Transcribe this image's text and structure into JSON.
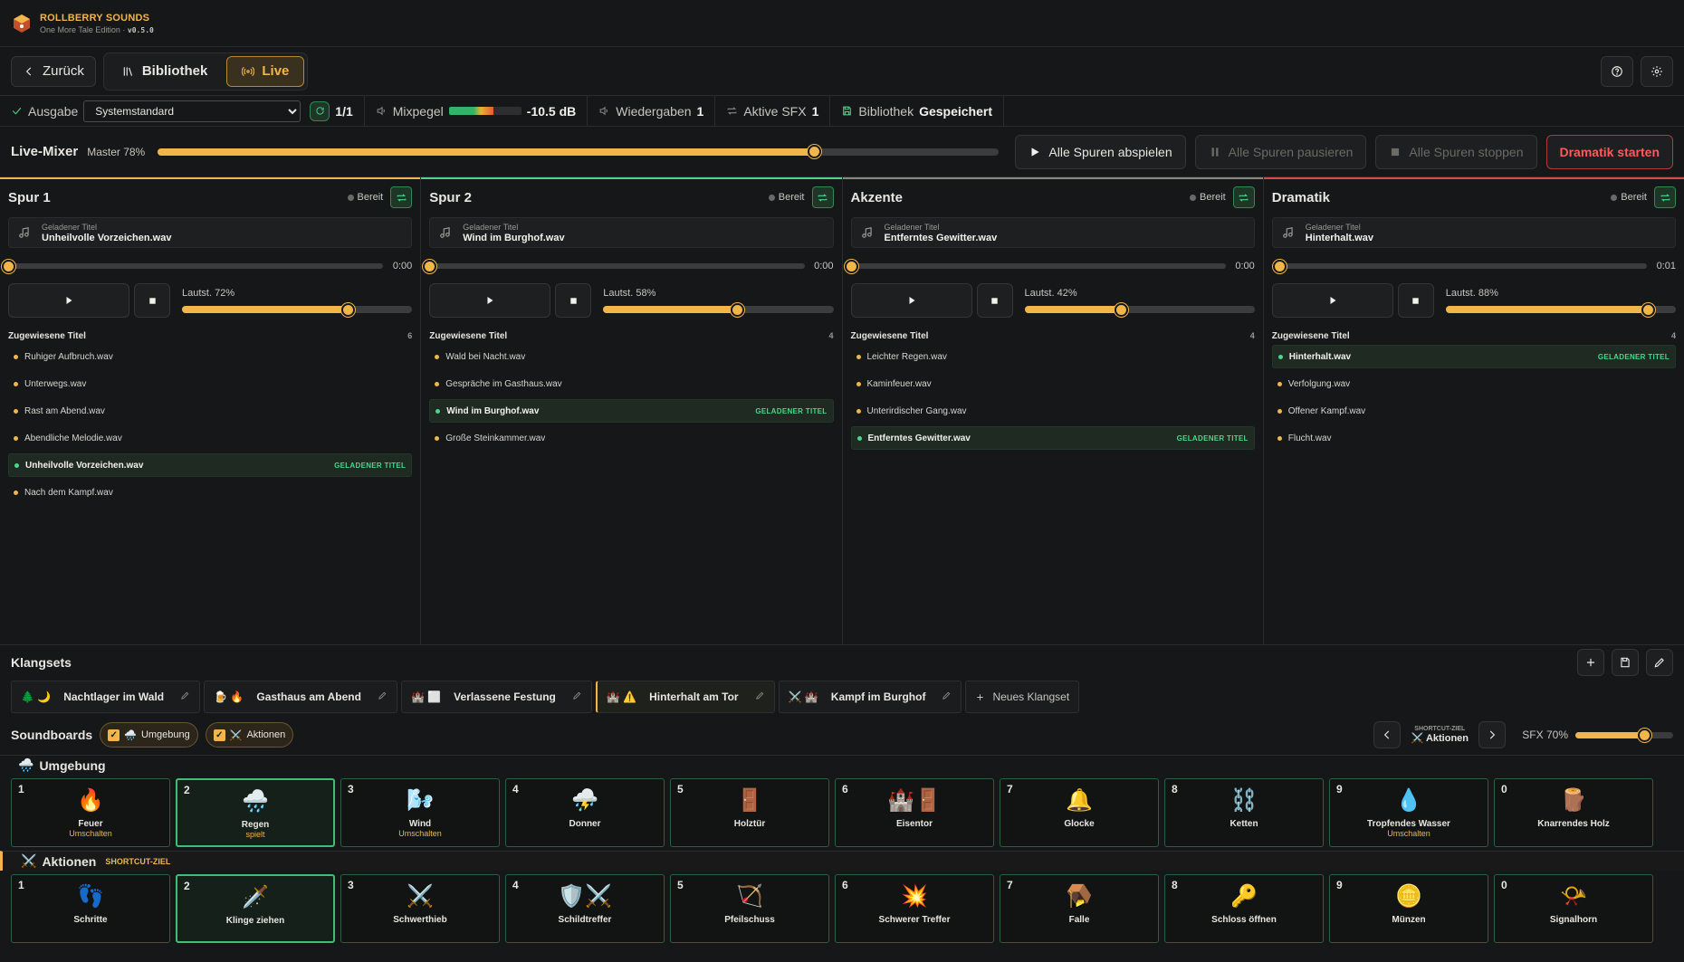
{
  "app": {
    "brand": "ROLLBERRY SOUNDS",
    "edition": "One More Tale Edition",
    "dot": "·",
    "version": "v0.5.0"
  },
  "nav": {
    "back": "Zurück",
    "library": "Bibliothek",
    "live": "Live"
  },
  "status": {
    "output_label": "Ausgabe",
    "output_value": "Systemstandard",
    "count": "1/1",
    "mix_label": "Mixpegel",
    "mix_value": "-10.5 dB",
    "mix_level_fraction": 0.62,
    "playback_label": "Wiedergaben",
    "playback_value": "1",
    "sfx_label": "Aktive SFX",
    "sfx_value": "1",
    "lib_label": "Bibliothek",
    "lib_value": "Gespeichert"
  },
  "mixer": {
    "title": "Live-Mixer",
    "master": "Master 78%",
    "master_fraction": 0.78,
    "play_all": "Alle Spuren abspielen",
    "pause_all": "Alle Spuren pausieren",
    "stop_all": "Alle Spuren stoppen",
    "dramatic": "Dramatik starten"
  },
  "tracks": [
    {
      "name": "Spur 1",
      "state": "Bereit",
      "color": "#f0b64a",
      "loaded_label": "Geladener Titel",
      "loaded": "Unheilvolle Vorzeichen.wav",
      "time": "0:00",
      "pos": 0.0,
      "vol_label": "Lautst. 72%",
      "vol": 0.72,
      "assigned_label": "Zugewiesene Titel",
      "count": "6",
      "items": [
        "Ruhiger Aufbruch.wav",
        "Unterwegs.wav",
        "Rast am Abend.wav",
        "Abendliche Melodie.wav",
        "Unheilvolle Vorzeichen.wav",
        "Nach dem Kampf.wav"
      ],
      "current": 4
    },
    {
      "name": "Spur 2",
      "state": "Bereit",
      "color": "#4cd68a",
      "loaded_label": "Geladener Titel",
      "loaded": "Wind im Burghof.wav",
      "time": "0:00",
      "pos": 0.0,
      "vol_label": "Lautst. 58%",
      "vol": 0.58,
      "assigned_label": "Zugewiesene Titel",
      "count": "4",
      "items": [
        "Wald bei Nacht.wav",
        "Gespräche im Gasthaus.wav",
        "Wind im Burghof.wav",
        "Große Steinkammer.wav"
      ],
      "current": 2
    },
    {
      "name": "Akzente",
      "state": "Bereit",
      "color": "#8a8883",
      "loaded_label": "Geladener Titel",
      "loaded": "Entferntes Gewitter.wav",
      "time": "0:00",
      "pos": 0.0,
      "vol_label": "Lautst. 42%",
      "vol": 0.42,
      "assigned_label": "Zugewiesene Titel",
      "count": "4",
      "items": [
        "Leichter Regen.wav",
        "Kaminfeuer.wav",
        "Unterirdischer Gang.wav",
        "Entferntes Gewitter.wav"
      ],
      "current": 3
    },
    {
      "name": "Dramatik",
      "state": "Bereit",
      "color": "#e04848",
      "loaded_label": "Geladener Titel",
      "loaded": "Hinterhalt.wav",
      "time": "0:01",
      "pos": 0.02,
      "vol_label": "Lautst. 88%",
      "vol": 0.88,
      "assigned_label": "Zugewiesene Titel",
      "count": "4",
      "items": [
        "Hinterhalt.wav",
        "Verfolgung.wav",
        "Offener Kampf.wav",
        "Flucht.wav"
      ],
      "current": 0
    }
  ],
  "loaded_tag": "GELADENER TITEL",
  "klangsets": {
    "title": "Klangsets",
    "items": [
      {
        "icons": "🌲 🌙",
        "name": "Nachtlager im Wald"
      },
      {
        "icons": "🍺 🔥",
        "name": "Gasthaus am Abend"
      },
      {
        "icons": "🏰 ⬜",
        "name": "Verlassene Festung"
      },
      {
        "icons": "🏰 ⚠️",
        "name": "Hinterhalt am Tor"
      },
      {
        "icons": "⚔️ 🏰",
        "name": "Kampf im Burghof"
      }
    ],
    "active": 3,
    "new": "Neues Klangset"
  },
  "soundboards": {
    "title": "Soundboards",
    "chip1": "Umgebung",
    "chip1_icon": "🌧️",
    "chip2": "Aktionen",
    "chip2_icon": "⚔️",
    "shortcut_label": "SHORTCUT-ZIEL",
    "shortcut_value": "Aktionen",
    "shortcut_icon": "⚔️",
    "sfx": "SFX 70%",
    "sfx_fraction": 0.7
  },
  "boards": [
    {
      "title": "Umgebung",
      "icon": "🌧️",
      "tag": "",
      "pads": [
        {
          "n": "1",
          "icon": "🔥",
          "label": "Feuer",
          "sub": "Umschalten"
        },
        {
          "n": "2",
          "icon": "🌧️",
          "label": "Regen",
          "sub": "spielt",
          "on": true
        },
        {
          "n": "3",
          "icon": "🌬️",
          "label": "Wind",
          "sub": "Umschalten"
        },
        {
          "n": "4",
          "icon": "⛈️",
          "label": "Donner",
          "sub": ""
        },
        {
          "n": "5",
          "icon": "🚪",
          "label": "Holztür",
          "sub": ""
        },
        {
          "n": "6",
          "icon": "🏰🚪",
          "label": "Eisentor",
          "sub": ""
        },
        {
          "n": "7",
          "icon": "🔔",
          "label": "Glocke",
          "sub": ""
        },
        {
          "n": "8",
          "icon": "⛓️",
          "label": "Ketten",
          "sub": ""
        },
        {
          "n": "9",
          "icon": "💧",
          "label": "Tropfendes Wasser",
          "sub": "Umschalten"
        },
        {
          "n": "0",
          "icon": "🪵",
          "label": "Knarrendes Holz",
          "sub": ""
        }
      ]
    },
    {
      "title": "Aktionen",
      "icon": "⚔️",
      "tag": "SHORTCUT-ZIEL",
      "pads": [
        {
          "n": "1",
          "icon": "👣",
          "label": "Schritte",
          "sub": ""
        },
        {
          "n": "2",
          "icon": "🗡️",
          "label": "Klinge ziehen",
          "sub": "",
          "on": true
        },
        {
          "n": "3",
          "icon": "⚔️",
          "label": "Schwerthieb",
          "sub": ""
        },
        {
          "n": "4",
          "icon": "🛡️⚔️",
          "label": "Schildtreffer",
          "sub": ""
        },
        {
          "n": "5",
          "icon": "🏹",
          "label": "Pfeilschuss",
          "sub": ""
        },
        {
          "n": "6",
          "icon": "💥",
          "label": "Schwerer Treffer",
          "sub": ""
        },
        {
          "n": "7",
          "icon": "🪤",
          "label": "Falle",
          "sub": ""
        },
        {
          "n": "8",
          "icon": "🔑",
          "label": "Schloss öffnen",
          "sub": ""
        },
        {
          "n": "9",
          "icon": "🪙",
          "label": "Münzen",
          "sub": ""
        },
        {
          "n": "0",
          "icon": "📯",
          "label": "Signalhorn",
          "sub": ""
        }
      ]
    }
  ]
}
